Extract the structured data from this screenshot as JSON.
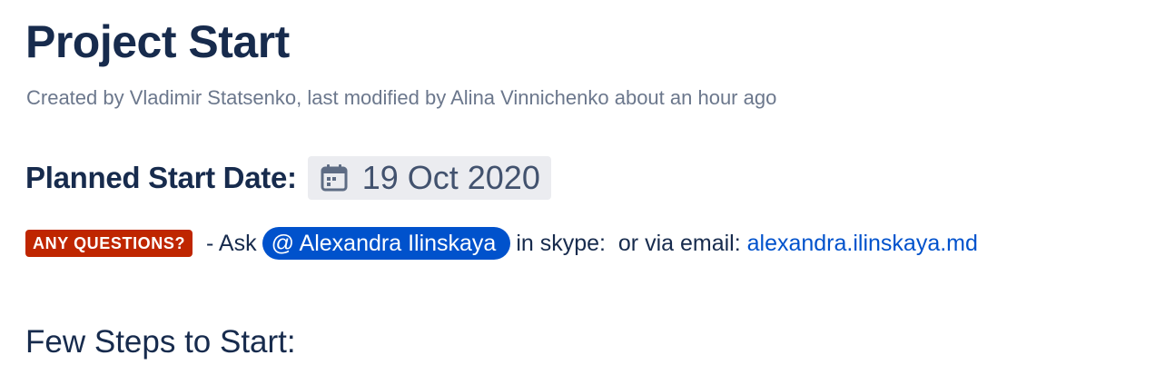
{
  "page": {
    "title": "Project Start",
    "byline": "Created by Vladimir Statsenko, last modified by Alina Vinnichenko about an hour ago"
  },
  "start_date": {
    "label": "Planned Start Date:",
    "icon": "calendar-icon",
    "value": "19 Oct 2020"
  },
  "questions": {
    "status_label": "ANY QUESTIONS?",
    "status_color": "#bf2600",
    "text_before": " - Ask",
    "mention": "@ Alexandra Ilinskaya",
    "mention_color": "#0052cc",
    "text_middle": "in skype:  or via email: ",
    "email_link": "alexandra.ilinskaya.md"
  },
  "steps": {
    "heading": "Few Steps to Start:"
  }
}
